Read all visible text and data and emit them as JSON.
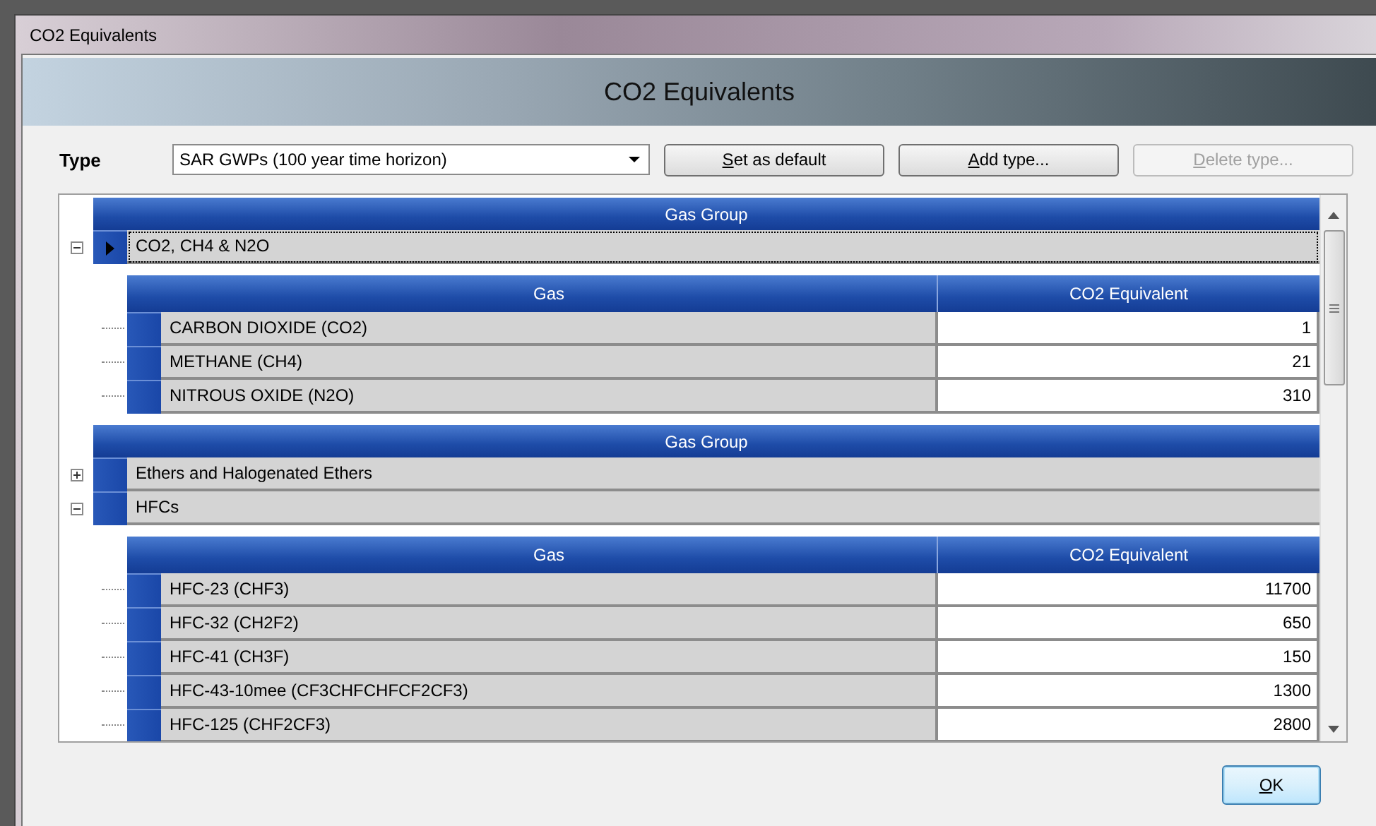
{
  "window": {
    "title": "CO2 Equivalents"
  },
  "header": {
    "title": "CO2 Equivalents"
  },
  "type_label": "Type",
  "type_select": {
    "value": "SAR GWPs (100 year time horizon)"
  },
  "buttons": [
    {
      "label": "Set as default",
      "disabled": false,
      "access_key_underlined": true
    },
    {
      "label": "Add type...",
      "disabled": false,
      "access_key_underlined": true
    },
    {
      "label": "Delete type...",
      "disabled": true,
      "access_key_underlined": true
    }
  ],
  "grid": {
    "bands": [
      {
        "header": "Gas Group",
        "groups": [
          {
            "name": "CO2, CH4 & N2O",
            "expanded": true,
            "current": true,
            "columns": [
              "Gas",
              "CO2 Equivalent"
            ],
            "rows": [
              {
                "gas": "CARBON DIOXIDE (CO2)",
                "value": "1"
              },
              {
                "gas": "METHANE (CH4)",
                "value": "21"
              },
              {
                "gas": "NITROUS OXIDE (N2O)",
                "value": "310"
              }
            ]
          }
        ]
      },
      {
        "header": "Gas Group",
        "groups": [
          {
            "name": "Ethers and Halogenated Ethers",
            "expanded": false,
            "current": false
          },
          {
            "name": "HFCs",
            "expanded": true,
            "current": false,
            "columns": [
              "Gas",
              "CO2 Equivalent"
            ],
            "rows": [
              {
                "gas": "HFC-23 (CHF3)",
                "value": "11700"
              },
              {
                "gas": "HFC-32 (CH2F2)",
                "value": "650"
              },
              {
                "gas": "HFC-41 (CH3F)",
                "value": "150"
              },
              {
                "gas": "HFC-43-10mee (CF3CHFCHFCF2CF3)",
                "value": "1300"
              },
              {
                "gas": "HFC-125 (CHF2CF3)",
                "value": "2800"
              }
            ]
          }
        ]
      }
    ]
  },
  "ok_button": {
    "label": "OK",
    "access_key_underlined": true
  }
}
